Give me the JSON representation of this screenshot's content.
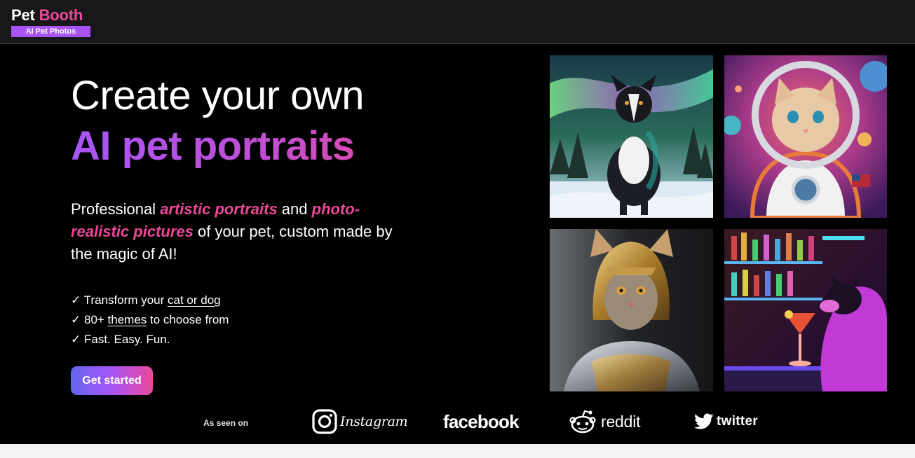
{
  "header": {
    "logo_word_1": "Pet",
    "logo_word_2": "Booth",
    "logo_badge": "AI Pet Photos"
  },
  "hero": {
    "headline_line_1": "Create your own",
    "headline_line_2": "AI pet portraits",
    "desc_part_1": "Professional ",
    "desc_highlight_1": "artistic portraits",
    "desc_part_2": " and ",
    "desc_highlight_2": "photo-realistic pictures",
    "desc_part_3": " of your pet, custom made by the magic of AI!",
    "features": [
      {
        "check": "✓",
        "prefix": "Transform your ",
        "link": "cat or dog",
        "suffix": ""
      },
      {
        "check": "✓",
        "prefix": "80+ ",
        "link": "themes",
        "suffix": " to choose from"
      },
      {
        "check": "✓",
        "prefix": "Fast. Easy. Fun.",
        "link": "",
        "suffix": ""
      }
    ],
    "cta_label": "Get started"
  },
  "gallery": {
    "images": [
      {
        "icon": "dog-aurora-portrait"
      },
      {
        "icon": "cat-astronaut-portrait"
      },
      {
        "icon": "cat-knight-portrait"
      },
      {
        "icon": "dog-bar-portrait"
      }
    ]
  },
  "seen_on": {
    "label": "As seen on",
    "brands": {
      "instagram": "Instagram",
      "facebook": "facebook",
      "reddit": "reddit",
      "twitter": "twitter"
    }
  },
  "colors": {
    "accent_pink": "#ec4899",
    "accent_purple": "#a855f7",
    "accent_indigo": "#6366f1",
    "header_bg": "#18181b",
    "hero_bg": "#000000"
  }
}
